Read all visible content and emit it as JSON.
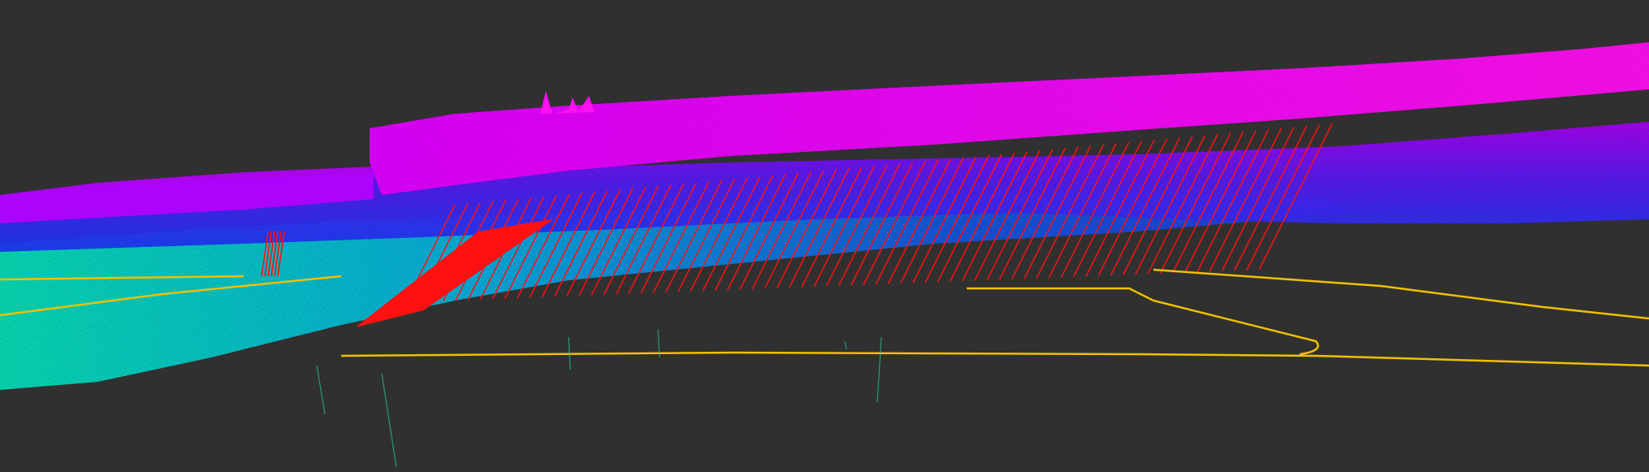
{
  "viewer": {
    "background_color": "#303030",
    "point_cloud_colormap": [
      "#00ffc8",
      "#00c8ff",
      "#0064ff",
      "#3c28ff",
      "#a000ff",
      "#ff00ff"
    ],
    "trajectory_color": "#f0c000",
    "correspondence_color": "#ff1010"
  }
}
